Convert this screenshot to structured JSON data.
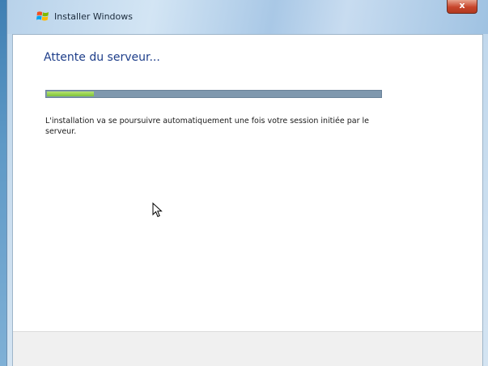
{
  "window": {
    "title": "Installer Windows",
    "close_label": "x"
  },
  "main": {
    "heading": "Attente du serveur...",
    "progress_percent": 14,
    "message": "L'installation va se poursuivre automatiquement une fois votre session initiée par le serveur."
  },
  "colors": {
    "heading": "#1e3e8a",
    "progress_fill": "#7cc23a",
    "progress_track": "#7f98ae"
  },
  "icons": {
    "title_icon": "windows-logo-icon",
    "cursor": "mouse-pointer-icon"
  }
}
